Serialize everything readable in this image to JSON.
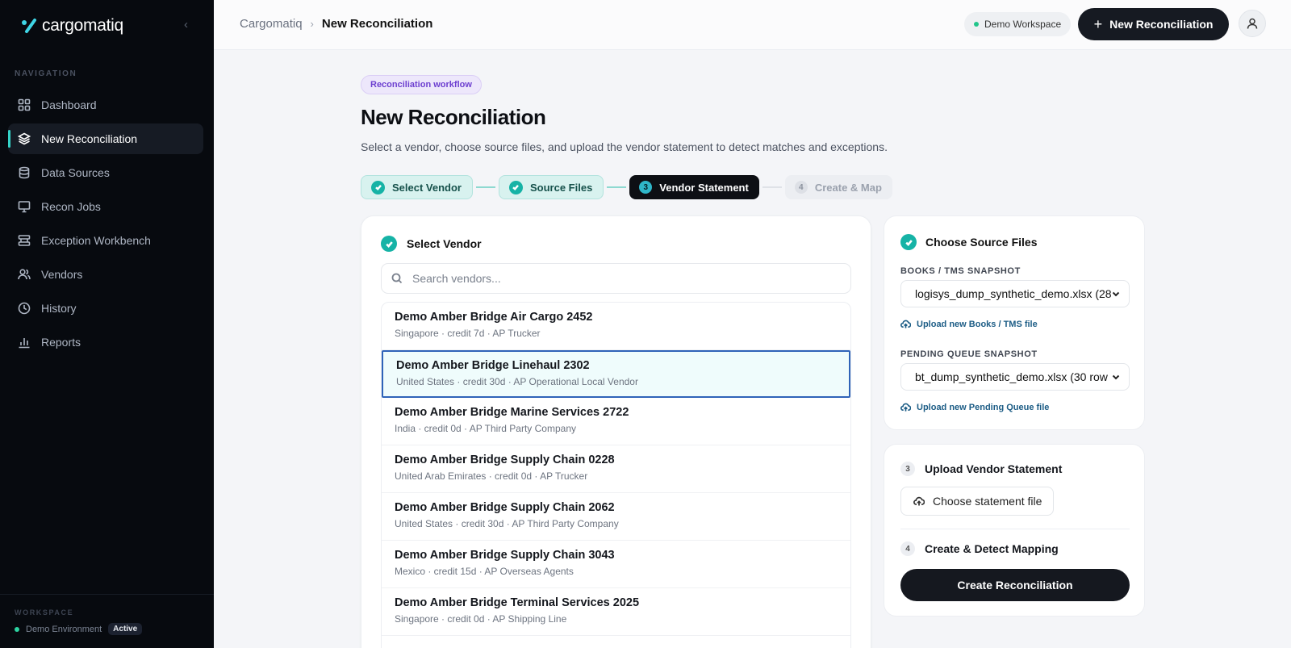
{
  "brand": {
    "name": "cargomatiq"
  },
  "sidebar": {
    "nav_heading": "NAVIGATION",
    "items": [
      {
        "label": "Dashboard",
        "icon": "grid-icon"
      },
      {
        "label": "New Reconciliation",
        "icon": "layers-icon",
        "active": true
      },
      {
        "label": "Data Sources",
        "icon": "database-icon"
      },
      {
        "label": "Recon Jobs",
        "icon": "monitor-icon"
      },
      {
        "label": "Exception Workbench",
        "icon": "workbench-icon"
      },
      {
        "label": "Vendors",
        "icon": "users-icon"
      },
      {
        "label": "History",
        "icon": "clock-icon"
      },
      {
        "label": "Reports",
        "icon": "bar-chart-icon"
      }
    ],
    "workspace_heading": "WORKSPACE",
    "workspace_name": "Demo Environment",
    "workspace_status": "Active"
  },
  "topbar": {
    "breadcrumb_root": "Cargomatiq",
    "breadcrumb_current": "New Reconciliation",
    "workspace_pill": "Demo Workspace",
    "new_button": "New Reconciliation"
  },
  "main": {
    "badge": "Reconciliation workflow",
    "title": "New Reconciliation",
    "subtitle": "Select a vendor, choose source files, and upload the vendor statement to detect matches and exceptions.",
    "steps": [
      {
        "label": "Select Vendor",
        "status": "done"
      },
      {
        "label": "Source Files",
        "status": "done"
      },
      {
        "label": "Vendor Statement",
        "status": "current",
        "number": "3"
      },
      {
        "label": "Create & Map",
        "status": "todo",
        "number": "4"
      }
    ]
  },
  "vendor_panel": {
    "title": "Select Vendor",
    "search_placeholder": "Search vendors...",
    "vendors": [
      {
        "name": "Demo Amber Bridge Air Cargo 2452",
        "meta": "Singapore · credit 7d · AP Trucker"
      },
      {
        "name": "Demo Amber Bridge Linehaul 2302",
        "meta": "United States · credit 30d · AP Operational Local Vendor",
        "selected": true
      },
      {
        "name": "Demo Amber Bridge Marine Services 2722",
        "meta": "India · credit 0d · AP Third Party Company"
      },
      {
        "name": "Demo Amber Bridge Supply Chain 0228",
        "meta": "United Arab Emirates · credit 0d · AP Trucker"
      },
      {
        "name": "Demo Amber Bridge Supply Chain 2062",
        "meta": "United States · credit 30d · AP Third Party Company"
      },
      {
        "name": "Demo Amber Bridge Supply Chain 3043",
        "meta": "Mexico · credit 15d · AP Overseas Agents"
      },
      {
        "name": "Demo Amber Bridge Terminal Services 2025",
        "meta": "Singapore · credit 0d · AP Shipping Line"
      }
    ]
  },
  "source_panel": {
    "title": "Choose Source Files",
    "books_label": "BOOKS / TMS SNAPSHOT",
    "books_value": "logisys_dump_synthetic_demo.xlsx (28",
    "books_upload": "Upload new Books / TMS file",
    "pending_label": "PENDING QUEUE SNAPSHOT",
    "pending_value": "bt_dump_synthetic_demo.xlsx (30 row",
    "pending_upload": "Upload new Pending Queue file"
  },
  "upload_panel": {
    "step3_num": "3",
    "step3_title": "Upload Vendor Statement",
    "choose_button": "Choose statement file",
    "step4_num": "4",
    "step4_title": "Create & Detect Mapping",
    "create_button": "Create Reconciliation"
  },
  "colors": {
    "accent_teal": "#16b3a6",
    "sidebar_bg": "#070a0f",
    "badge_purple": "#6d3fd0",
    "selected_border": "#2f63b8"
  }
}
